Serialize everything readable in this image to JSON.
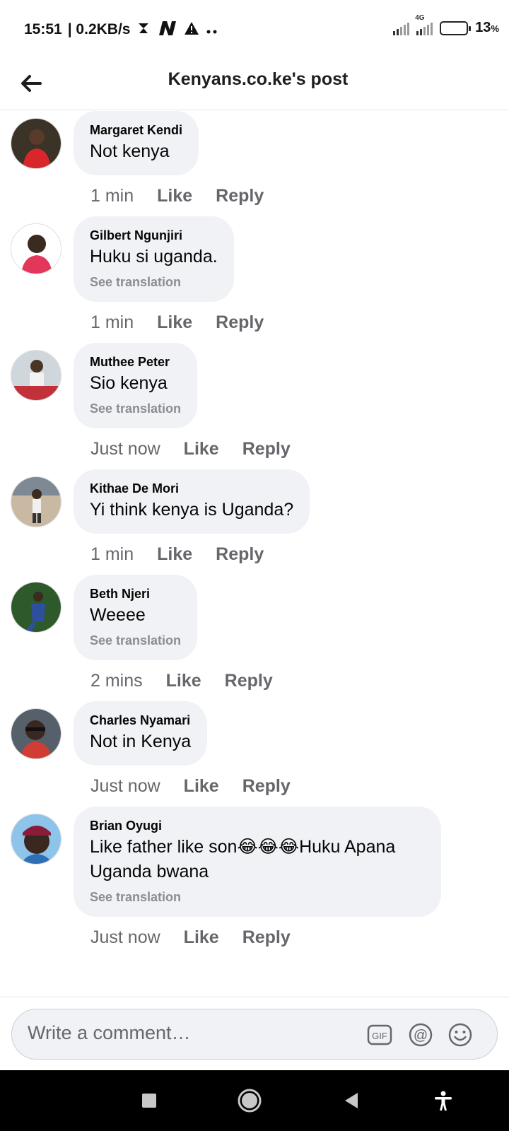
{
  "status_bar": {
    "time": "15:51",
    "speed": "| 0.2KB/s",
    "network_type": "4G",
    "battery_percent": "13",
    "battery_unit": "%",
    "battery_level": 0.13
  },
  "header": {
    "title": "Kenyans.co.ke's post"
  },
  "comments": [
    {
      "author": "Margaret Kendi",
      "text": "Not kenya",
      "time": "1 min",
      "like": "Like",
      "reply": "Reply"
    },
    {
      "author": "Gilbert Ngunjiri",
      "text": "Huku si uganda.",
      "translation": "See translation",
      "time": "1 min",
      "like": "Like",
      "reply": "Reply"
    },
    {
      "author": "Muthee Peter",
      "text": "Sio kenya",
      "translation": "See translation",
      "time": "Just now",
      "like": "Like",
      "reply": "Reply"
    },
    {
      "author": "Kithae De Mori",
      "text": "Yi think kenya is Uganda?",
      "time": "1 min",
      "like": "Like",
      "reply": "Reply"
    },
    {
      "author": "Beth Njeri",
      "text": "Weeee",
      "translation": "See translation",
      "time": "2 mins",
      "like": "Like",
      "reply": "Reply"
    },
    {
      "author": "Charles Nyamari",
      "text": "Not in Kenya",
      "time": "Just now",
      "like": "Like",
      "reply": "Reply"
    },
    {
      "author": "Brian Oyugi",
      "text": "Like father like son😂😂😂Huku Apana Uganda bwana",
      "translation": "See translation",
      "time": "Just now",
      "like": "Like",
      "reply": "Reply"
    }
  ],
  "composer": {
    "placeholder": "Write a comment…",
    "gif_label": "GIF",
    "mention_symbol": "@"
  },
  "colors": {
    "bubble": "#f0f2f5",
    "meta_text": "#65676b",
    "translate_text": "#8a8d91",
    "battery_low": "#e53935"
  },
  "icons": [
    "back-arrow-icon",
    "gif-icon",
    "mention-icon",
    "emoji-icon",
    "square-nav-icon",
    "home-nav-icon",
    "back-nav-icon",
    "accessibility-icon"
  ]
}
